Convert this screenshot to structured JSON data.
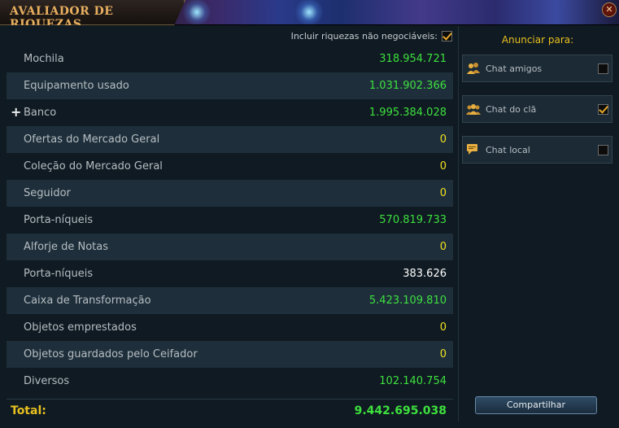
{
  "window": {
    "title": "AVALIADOR DE RIQUEZAS",
    "close_symbol": "✕"
  },
  "untradeable": {
    "label": "Incluir riquezas não negociáveis:",
    "checked": true
  },
  "rows": [
    {
      "label": "Mochila",
      "value": "318.954.721",
      "color": "g"
    },
    {
      "label": "Equipamento usado",
      "value": "1.031.902.366",
      "color": "g"
    },
    {
      "label": "Banco",
      "value": "1.995.384.028",
      "color": "g",
      "expand": "+"
    },
    {
      "label": "Ofertas do Mercado Geral",
      "value": "0",
      "color": "y"
    },
    {
      "label": "Coleção do Mercado Geral",
      "value": "0",
      "color": "y"
    },
    {
      "label": "Seguidor",
      "value": "0",
      "color": "y"
    },
    {
      "label": "Porta-níqueis",
      "value": "570.819.733",
      "color": "g"
    },
    {
      "label": "Alforje de Notas",
      "value": "0",
      "color": "y"
    },
    {
      "label": "Porta-níqueis",
      "value": "383.626",
      "color": "w"
    },
    {
      "label": "Caixa de Transformação",
      "value": "5.423.109.810",
      "color": "g"
    },
    {
      "label": "Objetos emprestados",
      "value": "0",
      "color": "y"
    },
    {
      "label": "Objetos guardados pelo Ceifador",
      "value": "0",
      "color": "y"
    },
    {
      "label": "Diversos",
      "value": "102.140.754",
      "color": "g"
    }
  ],
  "total": {
    "label": "Total:",
    "value": "9.442.695.038"
  },
  "announce": {
    "title": "Anunciar para:",
    "channels": [
      {
        "label": "Chat amigos",
        "checked": false,
        "icon": "friends-icon"
      },
      {
        "label": "Chat do clã",
        "checked": true,
        "icon": "clan-icon"
      },
      {
        "label": "Chat local",
        "checked": false,
        "icon": "speech-bubble-icon"
      }
    ]
  },
  "share_label": "Compartilhar",
  "colors": {
    "positive": "#3ee03e",
    "zero": "#f0e020",
    "neutral": "#ffffff",
    "accent": "#e8c020"
  }
}
